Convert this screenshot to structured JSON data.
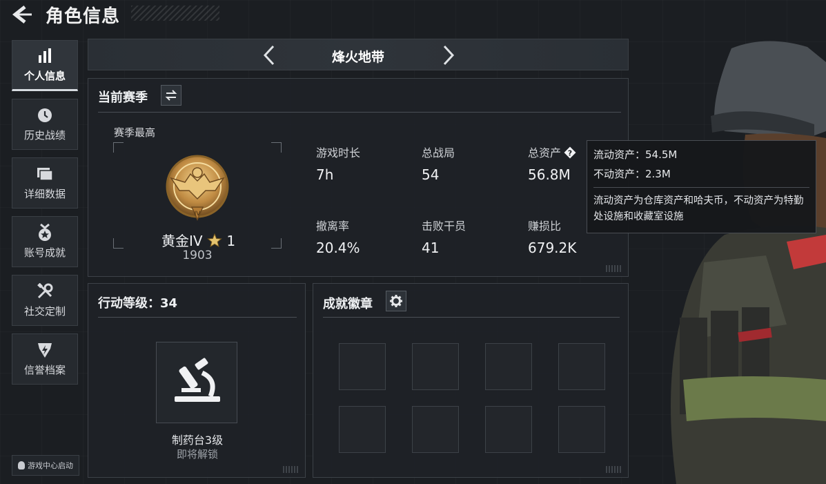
{
  "header": {
    "title": "角色信息"
  },
  "sidebar": {
    "items": [
      {
        "label": "个人信息",
        "active": true,
        "icon": "bar-chart-icon"
      },
      {
        "label": "历史战绩",
        "active": false,
        "icon": "clock-icon"
      },
      {
        "label": "详细数据",
        "active": false,
        "icon": "folder-icon"
      },
      {
        "label": "账号成就",
        "active": false,
        "icon": "medal-icon"
      },
      {
        "label": "社交定制",
        "active": false,
        "icon": "tools-icon"
      },
      {
        "label": "信誉档案",
        "active": false,
        "icon": "shield-bolt-icon"
      }
    ],
    "bottom_link": "游戏中心启动"
  },
  "mode": {
    "title": "烽火地带"
  },
  "season": {
    "title": "当前赛季",
    "best_label": "赛季最高",
    "rank_name": "黄金IV",
    "rank_stars": "1",
    "rank_score": "1903",
    "stats": [
      {
        "label": "游戏时长",
        "value": "7h"
      },
      {
        "label": "总战局",
        "value": "54"
      },
      {
        "label": "总资产",
        "value": "56.8M"
      },
      {
        "label": "撤离率",
        "value": "20.4%"
      },
      {
        "label": "击败干员",
        "value": "41"
      },
      {
        "label": "赚损比",
        "value": "679.2K"
      }
    ]
  },
  "tooltip": {
    "line1": "流动资产：54.5M",
    "line2": "不动资产：2.3M",
    "desc": "流动资产为仓库资产和哈夫币，不动资产为特勤处设施和收藏室设施"
  },
  "level": {
    "title": "行动等级：34",
    "item_name": "制药台3级",
    "item_status": "即将解锁"
  },
  "achievements": {
    "title": "成就徽章",
    "slots": 8
  },
  "colors": {
    "accent": "#d6dbe0",
    "background": "#1b1e22",
    "gold": "#c99a4c"
  }
}
